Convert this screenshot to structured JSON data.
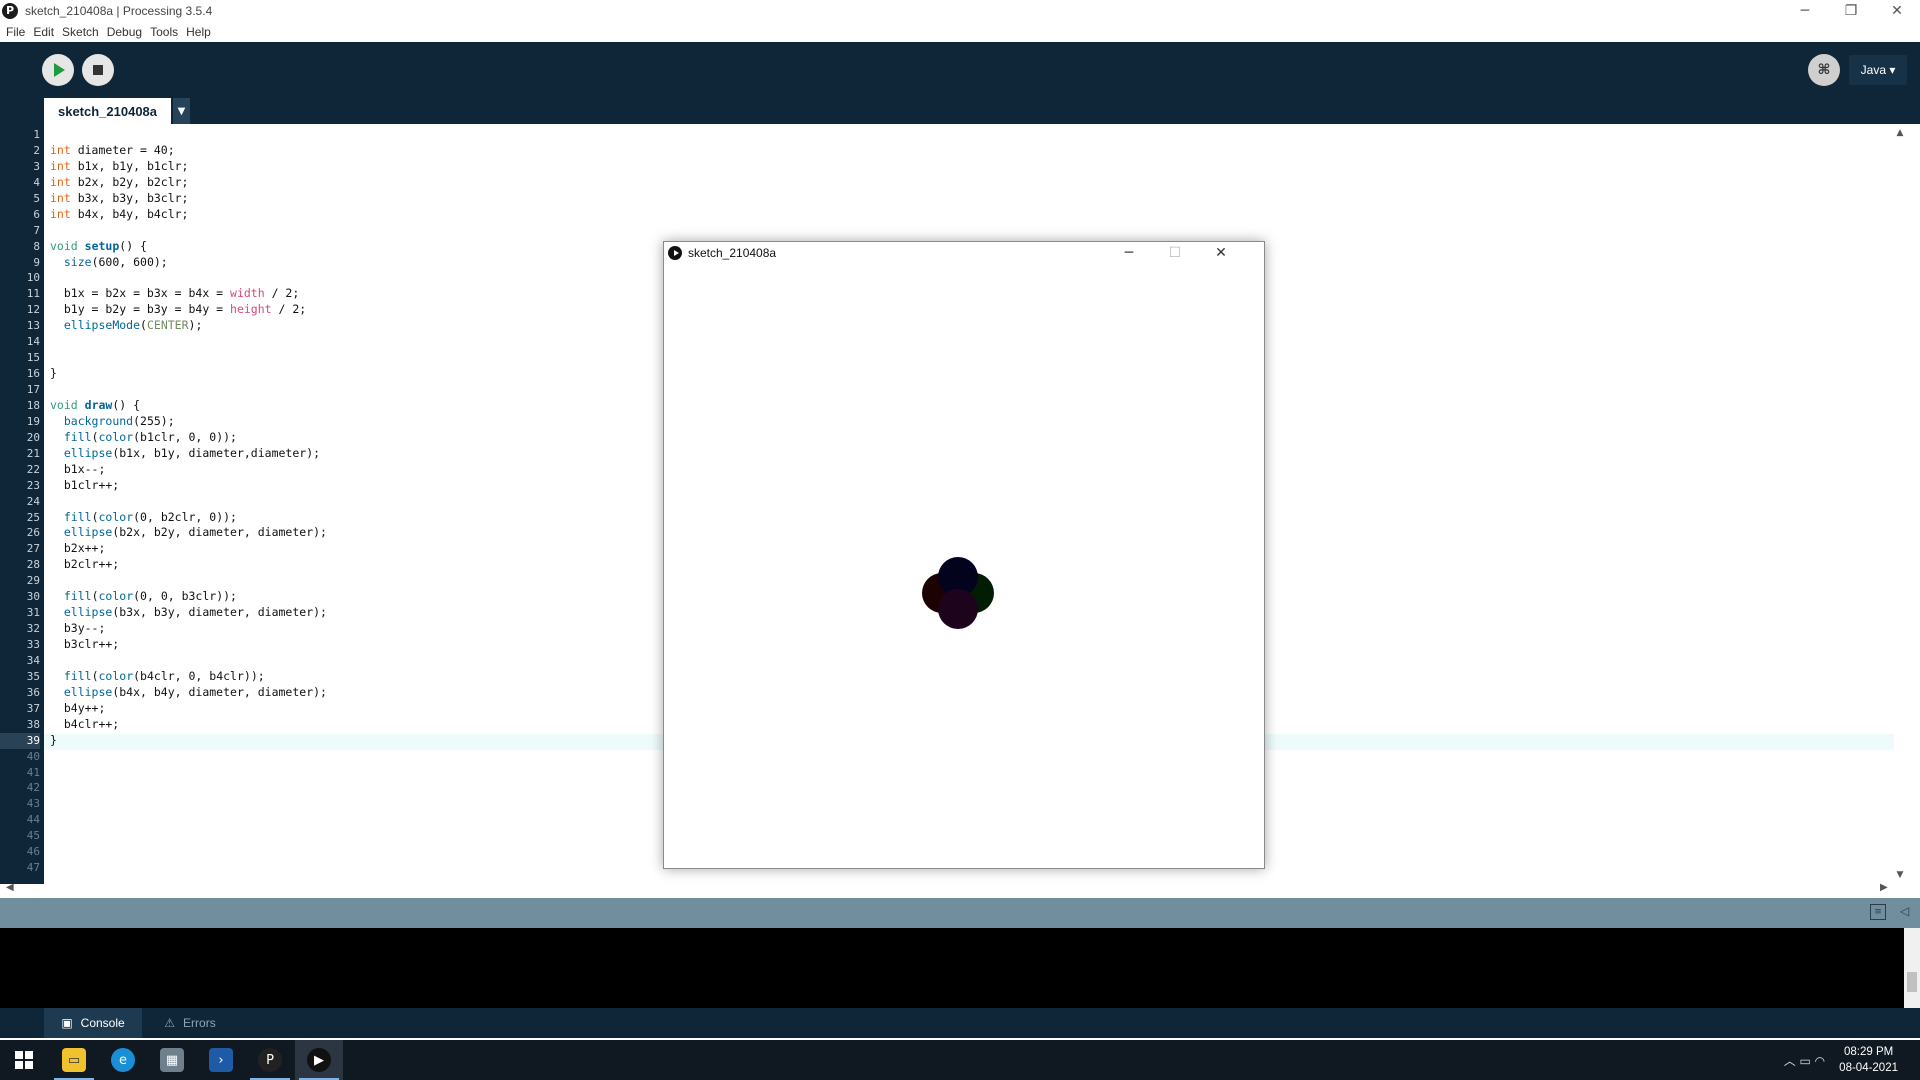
{
  "window": {
    "title": "sketch_210408a | Processing 3.5.4",
    "minimize": "─",
    "restore": "❐",
    "close": "✕"
  },
  "menu": [
    "File",
    "Edit",
    "Sketch",
    "Debug",
    "Tools",
    "Help"
  ],
  "toolbar": {
    "mode_label": "Java ▾",
    "debug_icon": "debug-icon"
  },
  "editor": {
    "tab_name": "sketch_210408a",
    "tab_menu_glyph": "▼",
    "current_line": 39,
    "total_lines": 47,
    "lines": [
      [],
      [
        {
          "t": "int",
          "c": "#e2661a"
        },
        {
          "t": " diameter = 40;"
        }
      ],
      [
        {
          "t": "int",
          "c": "#e2661a"
        },
        {
          "t": " b1x, b1y, b1clr;"
        }
      ],
      [
        {
          "t": "int",
          "c": "#e2661a"
        },
        {
          "t": " b2x, b2y, b2clr;"
        }
      ],
      [
        {
          "t": "int",
          "c": "#e2661a"
        },
        {
          "t": " b3x, b3y, b3clr;"
        }
      ],
      [
        {
          "t": "int",
          "c": "#e2661a"
        },
        {
          "t": " b4x, b4y, b4clr;"
        }
      ],
      [],
      [
        {
          "t": "void",
          "c": "#33997e"
        },
        {
          "t": " "
        },
        {
          "t": "setup",
          "c": "#006699",
          "b": true
        },
        {
          "t": "() {"
        }
      ],
      [
        {
          "t": "  "
        },
        {
          "t": "size",
          "c": "#006699"
        },
        {
          "t": "(600, 600);"
        }
      ],
      [],
      [
        {
          "t": "  b1x = b2x = b3x = b4x = "
        },
        {
          "t": "width",
          "c": "#d94a7a"
        },
        {
          "t": " / 2;"
        }
      ],
      [
        {
          "t": "  b1y = b2y = b3y = b4y = "
        },
        {
          "t": "height",
          "c": "#d94a7a"
        },
        {
          "t": " / 2;"
        }
      ],
      [
        {
          "t": "  "
        },
        {
          "t": "ellipseMode",
          "c": "#006699"
        },
        {
          "t": "("
        },
        {
          "t": "CENTER",
          "c": "#718a62"
        },
        {
          "t": ");"
        }
      ],
      [],
      [],
      [
        {
          "t": "}"
        }
      ],
      [],
      [
        {
          "t": "void",
          "c": "#33997e"
        },
        {
          "t": " "
        },
        {
          "t": "draw",
          "c": "#006699",
          "b": true
        },
        {
          "t": "() {"
        }
      ],
      [
        {
          "t": "  "
        },
        {
          "t": "background",
          "c": "#006699"
        },
        {
          "t": "(255);"
        }
      ],
      [
        {
          "t": "  "
        },
        {
          "t": "fill",
          "c": "#006699"
        },
        {
          "t": "("
        },
        {
          "t": "color",
          "c": "#006699"
        },
        {
          "t": "(b1clr, 0, 0));"
        }
      ],
      [
        {
          "t": "  "
        },
        {
          "t": "ellipse",
          "c": "#006699"
        },
        {
          "t": "(b1x, b1y, diameter,diameter);"
        }
      ],
      [
        {
          "t": "  b1x--;"
        }
      ],
      [
        {
          "t": "  b1clr++;"
        }
      ],
      [],
      [
        {
          "t": "  "
        },
        {
          "t": "fill",
          "c": "#006699"
        },
        {
          "t": "("
        },
        {
          "t": "color",
          "c": "#006699"
        },
        {
          "t": "(0, b2clr, 0));"
        }
      ],
      [
        {
          "t": "  "
        },
        {
          "t": "ellipse",
          "c": "#006699"
        },
        {
          "t": "(b2x, b2y, diameter, diameter);"
        }
      ],
      [
        {
          "t": "  b2x++;"
        }
      ],
      [
        {
          "t": "  b2clr++;"
        }
      ],
      [],
      [
        {
          "t": "  "
        },
        {
          "t": "fill",
          "c": "#006699"
        },
        {
          "t": "("
        },
        {
          "t": "color",
          "c": "#006699"
        },
        {
          "t": "(0, 0, b3clr));"
        }
      ],
      [
        {
          "t": "  "
        },
        {
          "t": "ellipse",
          "c": "#006699"
        },
        {
          "t": "(b3x, b3y, diameter, diameter);"
        }
      ],
      [
        {
          "t": "  b3y--;"
        }
      ],
      [
        {
          "t": "  b3clr++;"
        }
      ],
      [],
      [
        {
          "t": "  "
        },
        {
          "t": "fill",
          "c": "#006699"
        },
        {
          "t": "("
        },
        {
          "t": "color",
          "c": "#006699"
        },
        {
          "t": "(b4clr, 0, b4clr));"
        }
      ],
      [
        {
          "t": "  "
        },
        {
          "t": "ellipse",
          "c": "#006699"
        },
        {
          "t": "(b4x, b4y, diameter, diameter);"
        }
      ],
      [
        {
          "t": "  b4y++;"
        }
      ],
      [
        {
          "t": "  b4clr++;"
        }
      ],
      [
        {
          "t": "}"
        }
      ]
    ]
  },
  "console_tabs": {
    "console": "Console",
    "errors": "Errors"
  },
  "sketch_window": {
    "title": "sketch_210408a",
    "minimize": "─",
    "maximize": "☐",
    "close": "✕"
  },
  "taskbar": {
    "time": "08:29 PM",
    "date": "08-04-2021",
    "tray_glyphs": "︿  ▭  ◠"
  }
}
